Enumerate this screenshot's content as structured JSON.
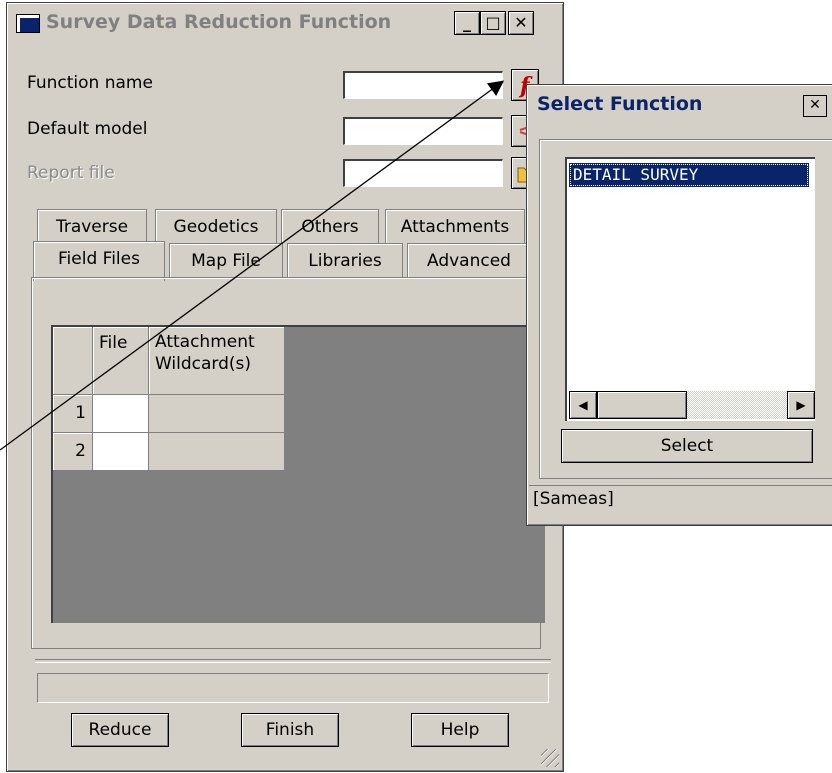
{
  "main_window": {
    "title": "Survey Data Reduction Function",
    "controls": {
      "minimize": "_",
      "maximize": "□",
      "close": "✕"
    },
    "fields": {
      "function_name_label": "Function name",
      "default_model_label": "Default model",
      "report_file_label": "Report file"
    },
    "tabs_row1": [
      "Traverse",
      "Geodetics",
      "Others",
      "Attachments"
    ],
    "tabs_row2": [
      "Field Files",
      "Map File",
      "Libraries",
      "Advanced"
    ],
    "grid": {
      "headers": [
        "File",
        "Attachment Wildcard(s)"
      ],
      "header_line1": "Attachment",
      "header_line2": "Wildcard(s)",
      "rows": [
        "1",
        "2"
      ]
    },
    "buttons": {
      "reduce": "Reduce",
      "finish": "Finish",
      "help": "Help"
    },
    "icons": {
      "function": "function-f-icon",
      "model": "model-icon",
      "report": "folder-icon"
    }
  },
  "select_function_popup": {
    "title": "Select Function",
    "close": "✕",
    "list_items": [
      "DETAIL SURVEY"
    ],
    "select_button": "Select",
    "status": "[Sameas]"
  }
}
